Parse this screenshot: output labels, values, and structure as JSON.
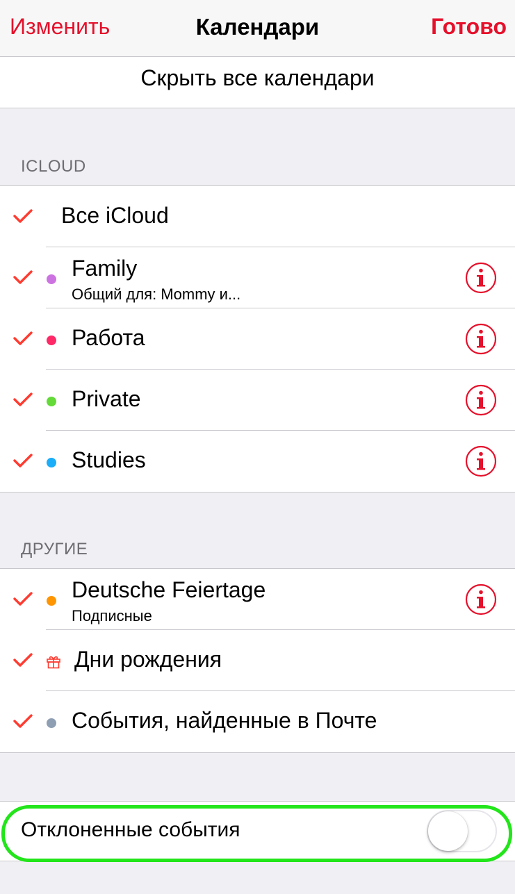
{
  "navbar": {
    "edit_label": "Изменить",
    "title": "Календари",
    "done_label": "Готово"
  },
  "hide_all_label": "Скрыть все календари",
  "icloud": {
    "header": "ICLOUD",
    "all_label": "Все iCloud",
    "items": [
      {
        "label": "Family",
        "subtitle": "Общий для: Mommy и...",
        "color": "#cc73e1"
      },
      {
        "label": "Работа",
        "color": "#ff2968"
      },
      {
        "label": "Private",
        "color": "#63da38"
      },
      {
        "label": "Studies",
        "color": "#1badf8"
      }
    ]
  },
  "others": {
    "header": "ДРУГИЕ",
    "items": [
      {
        "label": "Deutsche Feiertage",
        "subtitle": "Подписные",
        "color": "#ff9500"
      },
      {
        "label": "Дни рождения",
        "icon": "gift-icon"
      },
      {
        "label": "События, найденные в Почте",
        "color": "#8e9eb3"
      }
    ]
  },
  "declined": {
    "label": "Отклоненные события",
    "enabled": false
  },
  "colors": {
    "accent": "#e5102b",
    "check": "#ff3b30",
    "highlight": "#22e51a"
  }
}
